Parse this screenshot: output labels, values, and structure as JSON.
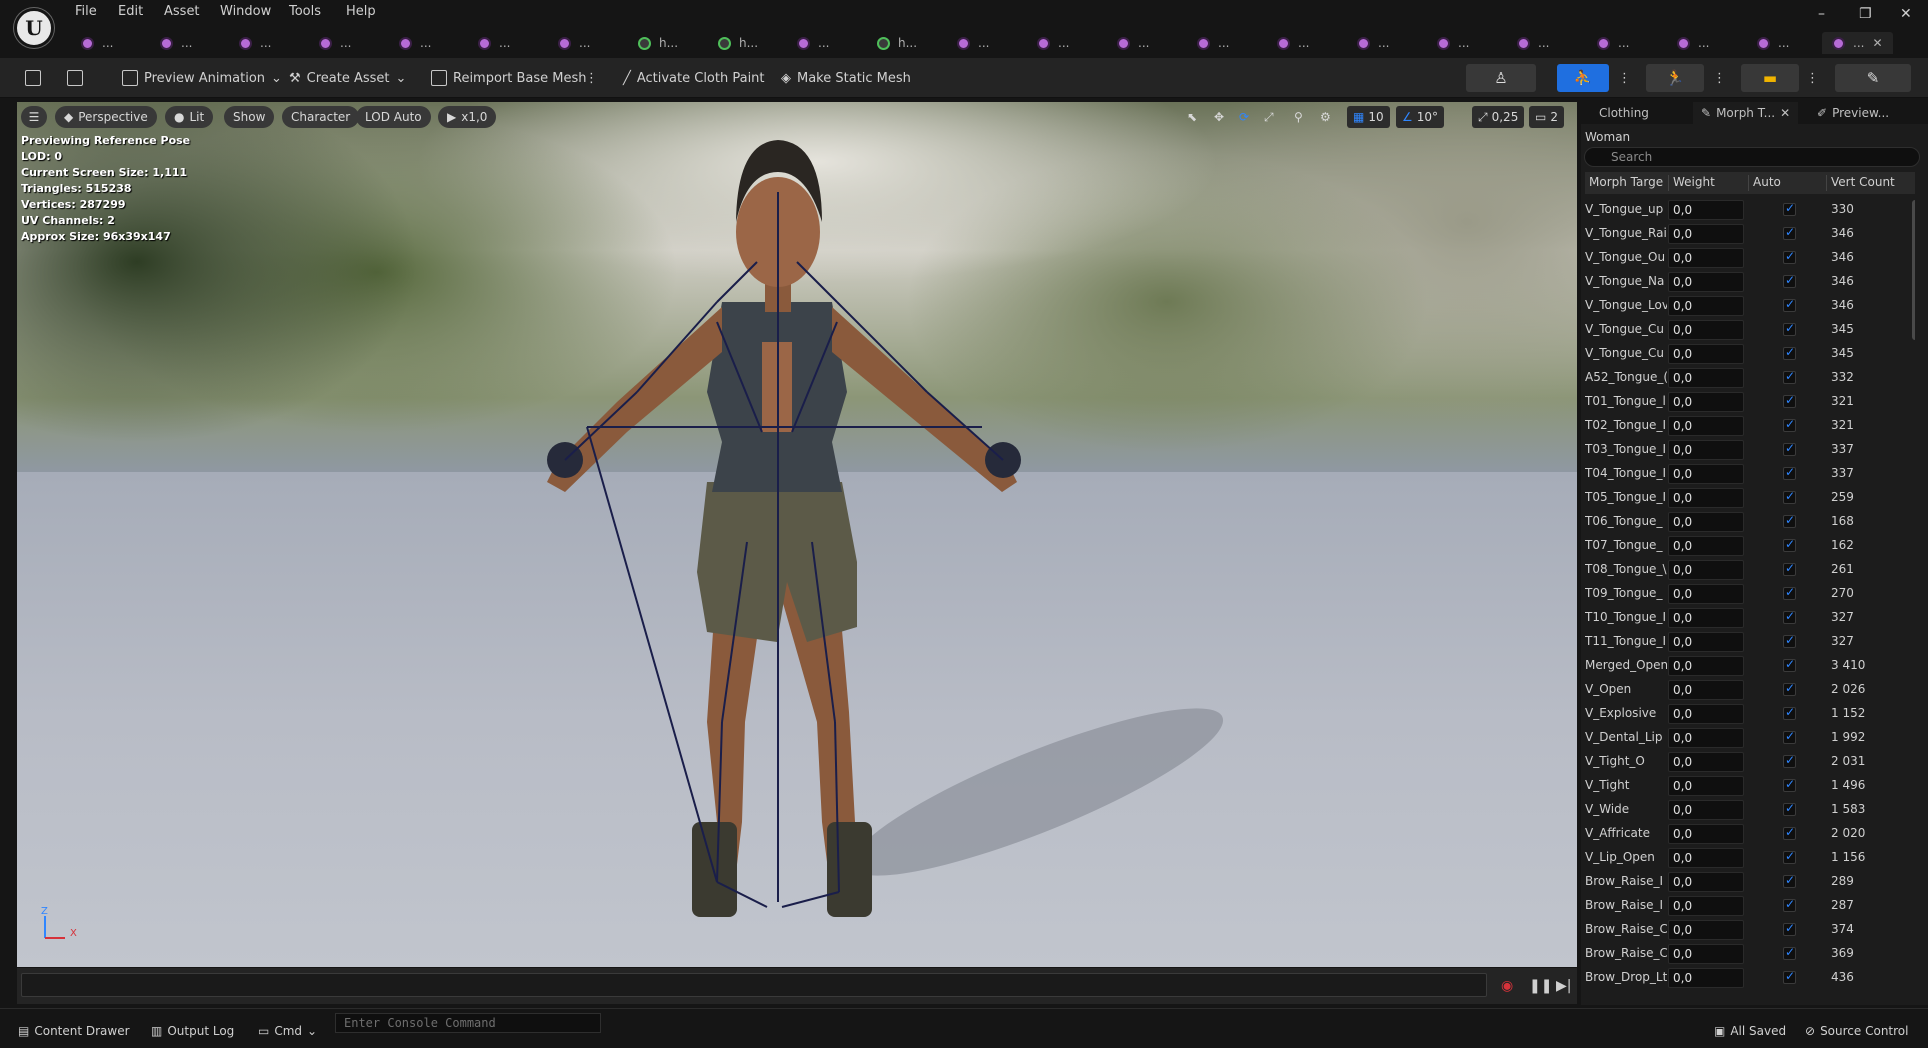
{
  "menu": {
    "items": [
      "File",
      "Edit",
      "Asset",
      "Window",
      "Tools",
      "Help"
    ]
  },
  "window_controls": {
    "minimize": "–",
    "restore": "❐",
    "close": "✕"
  },
  "tabs": [
    {
      "label": "...",
      "icon": "skeletal-mesh-icon"
    },
    {
      "label": "...",
      "icon": "skeletal-mesh-icon"
    },
    {
      "label": "...",
      "icon": "skeletal-mesh-icon"
    },
    {
      "label": "...",
      "icon": "skeletal-mesh-icon"
    },
    {
      "label": "...",
      "icon": "skeletal-mesh-icon"
    },
    {
      "label": "...",
      "icon": "skeletal-mesh-icon"
    },
    {
      "label": "...",
      "icon": "skeletal-mesh-icon"
    },
    {
      "label": "h...",
      "icon": "skeleton-icon"
    },
    {
      "label": "h...",
      "icon": "skeleton-icon"
    },
    {
      "label": "...",
      "icon": "skeletal-mesh-icon"
    },
    {
      "label": "h...",
      "icon": "skeleton-icon"
    },
    {
      "label": "...",
      "icon": "skeletal-mesh-icon"
    },
    {
      "label": "...",
      "icon": "skeletal-mesh-icon"
    },
    {
      "label": "...",
      "icon": "skeletal-mesh-icon"
    },
    {
      "label": "...",
      "icon": "skeletal-mesh-icon"
    },
    {
      "label": "...",
      "icon": "skeletal-mesh-icon"
    },
    {
      "label": "...",
      "icon": "skeletal-mesh-icon"
    },
    {
      "label": "...",
      "icon": "skeletal-mesh-icon"
    },
    {
      "label": "...",
      "icon": "skeletal-mesh-icon"
    },
    {
      "label": "...",
      "icon": "skeletal-mesh-icon"
    },
    {
      "label": "...",
      "icon": "skeletal-mesh-icon"
    },
    {
      "label": "...",
      "icon": "skeletal-mesh-icon"
    },
    {
      "label": "...",
      "icon": "skeletal-mesh-icon"
    }
  ],
  "active_tab": {
    "label": "...",
    "close": "✕"
  },
  "toolbar": {
    "preview_animation": "Preview Animation",
    "create_asset": "Create Asset",
    "reimport_base_mesh": "Reimport Base Mesh",
    "activate_cloth_paint": "Activate Cloth Paint",
    "make_static_mesh": "Make Static Mesh"
  },
  "viewport": {
    "perspective": "Perspective",
    "lit": "Lit",
    "show": "Show",
    "character": "Character",
    "lod_auto": "LOD Auto",
    "play_speed": "x1,0",
    "grid_snap": "10",
    "rotation_snap": "10°",
    "scale_snap": "0,25",
    "camera_speed": "2",
    "stats": [
      "Previewing Reference Pose",
      "LOD: 0",
      "Current Screen Size: 1,111",
      "Triangles: 515238",
      "Vertices: 287299",
      "UV Channels: 2",
      "Approx Size: 96x39x147"
    ],
    "axis_z": "Z",
    "axis_x": "X"
  },
  "panel": {
    "tabs": [
      "Clothing",
      "Morph T...",
      "Preview..."
    ],
    "active_tab_close": "✕",
    "mesh_name": "Woman",
    "search_placeholder": "Search",
    "columns": [
      "Morph Targe",
      "Weight",
      "Auto",
      "Vert Count"
    ],
    "rows": [
      {
        "name": "V_Tongue_up",
        "weight": "0,0",
        "verts": "330"
      },
      {
        "name": "V_Tongue_Rai",
        "weight": "0,0",
        "verts": "346"
      },
      {
        "name": "V_Tongue_Ou",
        "weight": "0,0",
        "verts": "346"
      },
      {
        "name": "V_Tongue_Na",
        "weight": "0,0",
        "verts": "346"
      },
      {
        "name": "V_Tongue_Lov",
        "weight": "0,0",
        "verts": "346"
      },
      {
        "name": "V_Tongue_Cu",
        "weight": "0,0",
        "verts": "345"
      },
      {
        "name": "V_Tongue_Cu",
        "weight": "0,0",
        "verts": "345"
      },
      {
        "name": "A52_Tongue_(",
        "weight": "0,0",
        "verts": "332"
      },
      {
        "name": "T01_Tongue_l",
        "weight": "0,0",
        "verts": "321"
      },
      {
        "name": "T02_Tongue_I",
        "weight": "0,0",
        "verts": "321"
      },
      {
        "name": "T03_Tongue_I",
        "weight": "0,0",
        "verts": "337"
      },
      {
        "name": "T04_Tongue_I",
        "weight": "0,0",
        "verts": "337"
      },
      {
        "name": "T05_Tongue_I",
        "weight": "0,0",
        "verts": "259"
      },
      {
        "name": "T06_Tongue_",
        "weight": "0,0",
        "verts": "168"
      },
      {
        "name": "T07_Tongue_",
        "weight": "0,0",
        "verts": "162"
      },
      {
        "name": "T08_Tongue_\\",
        "weight": "0,0",
        "verts": "261"
      },
      {
        "name": "T09_Tongue_",
        "weight": "0,0",
        "verts": "270"
      },
      {
        "name": "T10_Tongue_I",
        "weight": "0,0",
        "verts": "327"
      },
      {
        "name": "T11_Tongue_I",
        "weight": "0,0",
        "verts": "327"
      },
      {
        "name": "Merged_Open",
        "weight": "0,0",
        "verts": "3 410"
      },
      {
        "name": "V_Open",
        "weight": "0,0",
        "verts": "2 026"
      },
      {
        "name": "V_Explosive",
        "weight": "0,0",
        "verts": "1 152"
      },
      {
        "name": "V_Dental_Lip",
        "weight": "0,0",
        "verts": "1 992"
      },
      {
        "name": "V_Tight_O",
        "weight": "0,0",
        "verts": "2 031"
      },
      {
        "name": "V_Tight",
        "weight": "0,0",
        "verts": "1 496"
      },
      {
        "name": "V_Wide",
        "weight": "0,0",
        "verts": "1 583"
      },
      {
        "name": "V_Affricate",
        "weight": "0,0",
        "verts": "2 020"
      },
      {
        "name": "V_Lip_Open",
        "weight": "0,0",
        "verts": "1 156"
      },
      {
        "name": "Brow_Raise_I",
        "weight": "0,0",
        "verts": "289"
      },
      {
        "name": "Brow_Raise_I",
        "weight": "0,0",
        "verts": "287"
      },
      {
        "name": "Brow_Raise_C",
        "weight": "0,0",
        "verts": "374"
      },
      {
        "name": "Brow_Raise_C",
        "weight": "0,0",
        "verts": "369"
      },
      {
        "name": "Brow_Drop_Lt",
        "weight": "0,0",
        "verts": "436"
      }
    ]
  },
  "statusbar": {
    "content_drawer": "Content Drawer",
    "output_log": "Output Log",
    "cmd": "Cmd",
    "console_placeholder": "Enter Console Command",
    "all_saved": "All Saved",
    "source_control": "Source Control"
  },
  "colors": {
    "accent_blue": "#2f86ff",
    "record_red": "#d6323a",
    "skeleton": "#1a1e4a"
  }
}
